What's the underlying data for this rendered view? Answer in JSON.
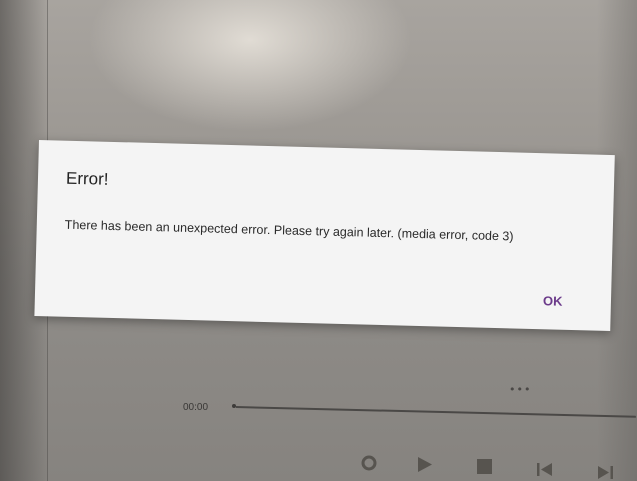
{
  "dialog": {
    "title": "Error!",
    "message": "There has been an unexpected error. Please try again later. (media error, code 3)",
    "ok_label": "OK",
    "ok_color": "#6b3a8a"
  },
  "player": {
    "time": "00:00",
    "more_icon": "more-horizontal-icon",
    "controls": [
      "record-icon",
      "play-icon",
      "stop-icon",
      "skip-previous-icon",
      "skip-next-icon"
    ]
  }
}
